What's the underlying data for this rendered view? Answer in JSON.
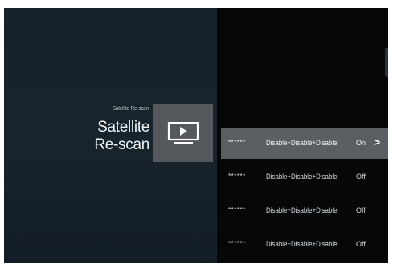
{
  "header": {
    "breadcrumb": "Satellite Re-scan",
    "title_line1": "Satellite",
    "title_line2": "Re-scan"
  },
  "tile": {
    "icon": "tv-play-icon"
  },
  "list": {
    "rows": [
      {
        "masked": "******",
        "modes": "Disable+Disable+Disable",
        "state": "On",
        "chevron": ">"
      },
      {
        "masked": "******",
        "modes": "Disable+Disable+Disable",
        "state": "Off"
      },
      {
        "masked": "******",
        "modes": "Disable+Disable+Disable",
        "state": "Off"
      },
      {
        "masked": "******",
        "modes": "Disable+Disable+Disable",
        "state": "Off"
      }
    ]
  },
  "colors": {
    "panel": "#18242d",
    "background": "#050708",
    "selected_row": "#5b5f63",
    "tile": "#55595d"
  }
}
